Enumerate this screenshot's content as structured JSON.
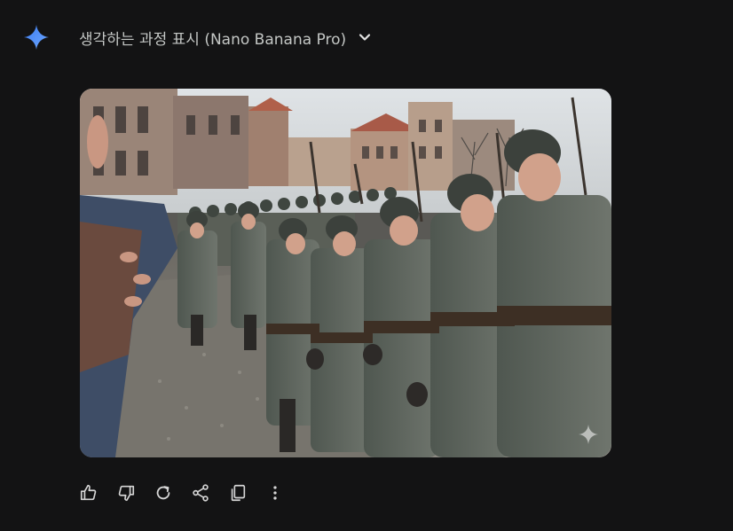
{
  "header": {
    "label": "생각하는 과정 표시 (Nano Banana Pro)",
    "expand_icon": "chevron-down-icon"
  },
  "logo_icon": "gemini-sparkle-icon",
  "image": {
    "description": "Colorized historical photo of helmeted soldiers marching on a cobblestone street while a crowd salutes",
    "watermark_icon": "sparkle-watermark-icon"
  },
  "actions": [
    {
      "icon": "thumbs-up-icon"
    },
    {
      "icon": "thumbs-down-icon"
    },
    {
      "icon": "regenerate-icon"
    },
    {
      "icon": "share-icon"
    },
    {
      "icon": "copy-icon"
    },
    {
      "icon": "more-vert-icon"
    }
  ],
  "colors": {
    "background": "#131314",
    "text": "#c4c7c5",
    "sparkle_blue": "#4b8ef5"
  }
}
